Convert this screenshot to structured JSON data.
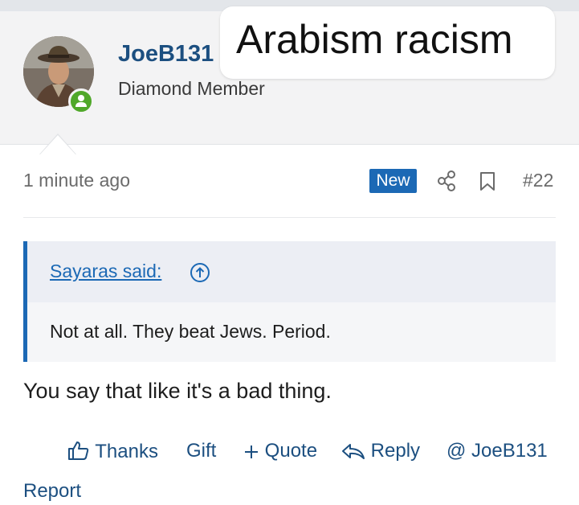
{
  "user": {
    "name": "JoeB131",
    "title": "Diamond Member"
  },
  "caption": "Arabism racism",
  "post": {
    "time": "1 minute ago",
    "new_label": "New",
    "number": "#22",
    "quote": {
      "author": "Sayaras said:",
      "text": "Not at all. They beat Jews. Period."
    },
    "body": "You say that like it's a bad thing."
  },
  "actions": {
    "thanks": "Thanks",
    "gift": "Gift",
    "quote": "Quote",
    "reply": "Reply",
    "mention": "@ JoeB131",
    "report": "Report"
  },
  "colors": {
    "accent": "#1c69b5",
    "link": "#1c4f80",
    "online": "#50a82a",
    "header_bg": "#f3f3f4"
  }
}
